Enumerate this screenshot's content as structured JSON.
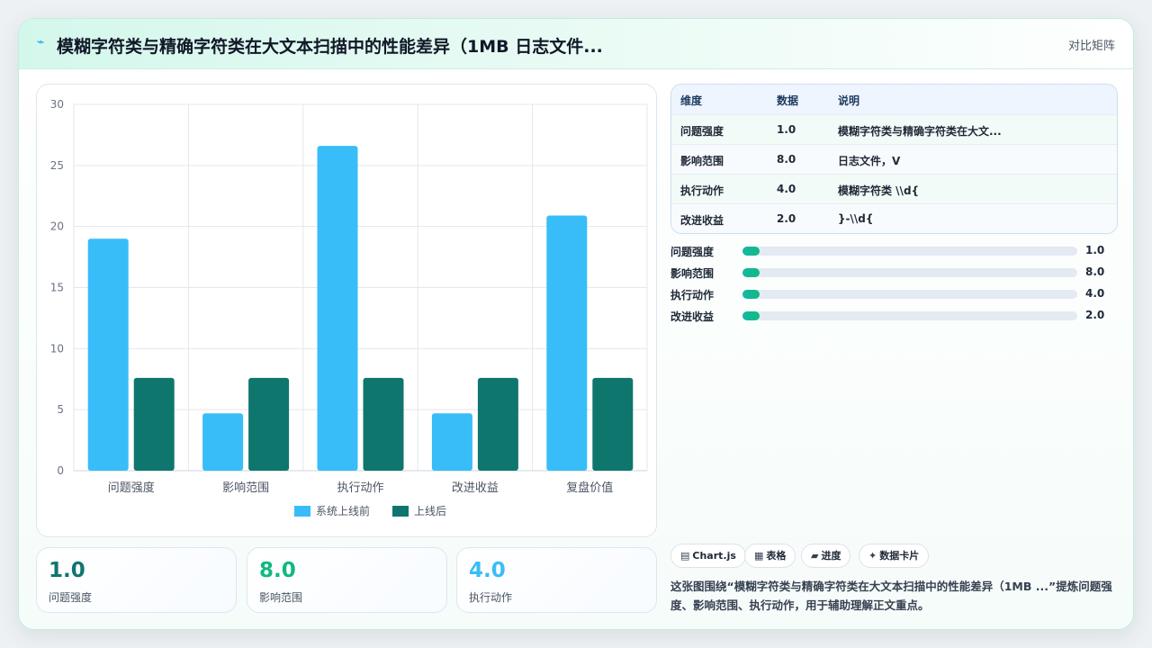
{
  "header": {
    "title": "模糊字符类与精确字符类在大文本扫描中的性能差异（1MB 日志文件...",
    "title_icon": "sparkline-icon",
    "link": "对比矩阵"
  },
  "colors": {
    "series_before": "#38bdf8",
    "series_after": "#0f766e",
    "kpi_1": "#0f766e",
    "kpi_2": "#10b981",
    "kpi_3": "#38bdf8"
  },
  "chart_data": {
    "type": "bar",
    "categories": [
      "问题强度",
      "影响范围",
      "执行动作",
      "改进收益",
      "复盘价值"
    ],
    "series": [
      {
        "name": "系统上线前",
        "values": [
          19,
          4.7,
          26.6,
          4.7,
          20.9
        ]
      },
      {
        "name": "上线后",
        "values": [
          7.6,
          7.6,
          7.6,
          7.6,
          7.6
        ]
      }
    ],
    "ylim": [
      0,
      30
    ],
    "yticks": [
      0,
      5,
      10,
      15,
      20,
      25,
      30
    ],
    "grid": true,
    "legend": "bottom"
  },
  "kpis": [
    {
      "value": "1.0",
      "label": "问题强度"
    },
    {
      "value": "8.0",
      "label": "影响范围"
    },
    {
      "value": "4.0",
      "label": "执行动作"
    }
  ],
  "table": {
    "headers": [
      "维度",
      "数据",
      "说明"
    ],
    "rows": [
      [
        "问题强度",
        "1.0",
        "模糊字符类与精确字符类在大文..."
      ],
      [
        "影响范围",
        "8.0",
        "日志文件，V"
      ],
      [
        "执行动作",
        "4.0",
        "模糊字符类 \\\\d{"
      ],
      [
        "改进收益",
        "2.0",
        "}-\\\\d{"
      ]
    ]
  },
  "progress": [
    {
      "label": "问题强度",
      "value": "1.0",
      "fraction": 0.05
    },
    {
      "label": "影响范围",
      "value": "8.0",
      "fraction": 0.05
    },
    {
      "label": "执行动作",
      "value": "4.0",
      "fraction": 0.05
    },
    {
      "label": "改进收益",
      "value": "2.0",
      "fraction": 0.05
    }
  ],
  "tags": [
    {
      "icon": "chart-icon",
      "glyph": "▤",
      "label": "Chart.js"
    },
    {
      "icon": "table-icon",
      "glyph": "▦",
      "label": "表格"
    },
    {
      "icon": "progress-icon",
      "glyph": "▰",
      "label": "进度"
    },
    {
      "icon": "sparkle-icon",
      "glyph": "✦",
      "label": "数据卡片"
    }
  ],
  "summary": "这张图围绕“模糊字符类与精确字符类在大文本扫描中的性能差异（1MB ...”提炼问题强度、影响范围、执行动作，用于辅助理解正文重点。"
}
